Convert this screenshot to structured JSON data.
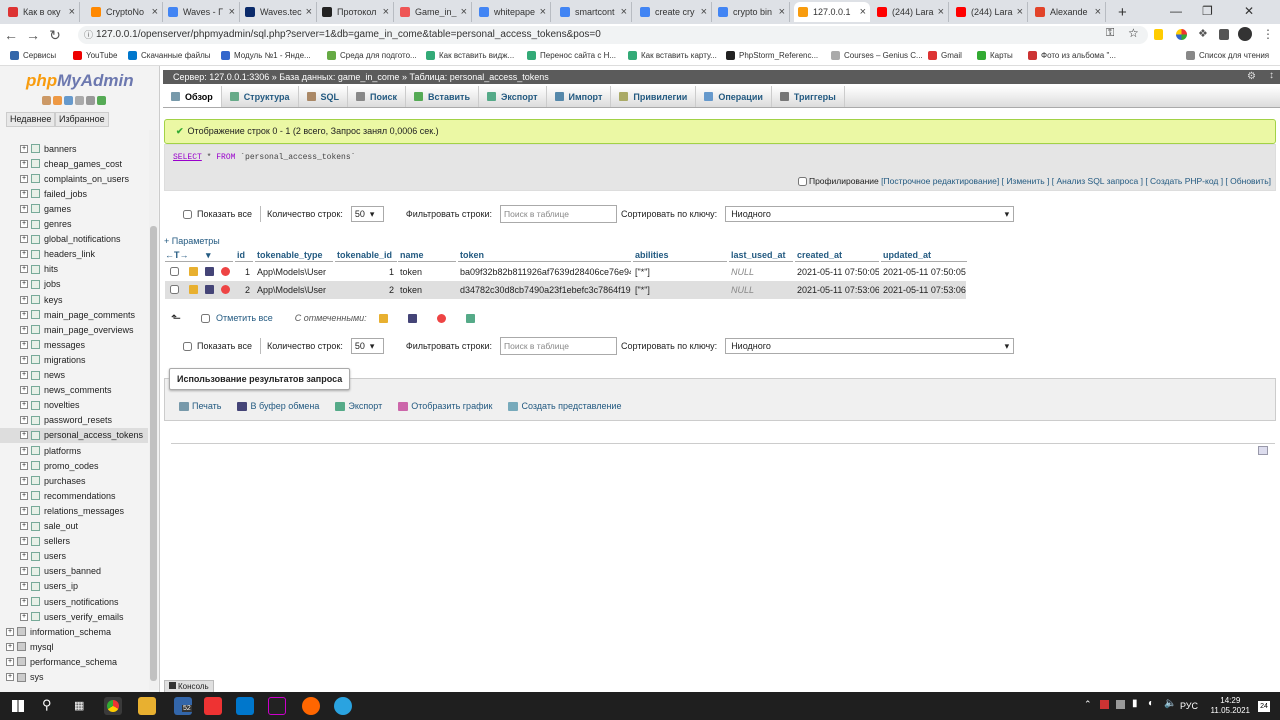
{
  "browser": {
    "tabs": [
      {
        "title": "Как в оку",
        "color": "#d33"
      },
      {
        "title": "CryptoNo",
        "color": "#f80"
      },
      {
        "title": "Waves - Г",
        "color": "#4285f4"
      },
      {
        "title": "Waves.tec",
        "color": "#0a2a6a"
      },
      {
        "title": "Протокол",
        "color": "#222"
      },
      {
        "title": "Game_in_",
        "color": "#e55"
      },
      {
        "title": "whitepape",
        "color": "#4285f4"
      },
      {
        "title": "smartcont",
        "color": "#4285f4"
      },
      {
        "title": "create cry",
        "color": "#4285f4"
      },
      {
        "title": "crypto bin",
        "color": "#4285f4"
      },
      {
        "title": "127.0.0.1",
        "color": "#f89c0e"
      },
      {
        "title": "(244) Lara",
        "color": "#f00"
      },
      {
        "title": "(244) Lara",
        "color": "#f00"
      },
      {
        "title": "Alexande",
        "color": "#e24329"
      }
    ],
    "new_tab": "+",
    "url": "127.0.0.1/openserver/phpmyadmin/sql.php?server=1&db=game_in_come&table=personal_access_tokens&pos=0",
    "bookmarks": [
      "Сервисы",
      "YouTube",
      "Скачанные файлы",
      "Модуль №1 - Яндe...",
      "Среда для подгото...",
      "Как вставить видж...",
      "Перенос сайта с Н...",
      "Как вставить карту...",
      "PhpStorm_Referenc...",
      "Courses – Genius C...",
      "Gmail",
      "Карты",
      "Фото из альбома \"..."
    ],
    "reading_list": "Список для чтения"
  },
  "left": {
    "logo_php": "php",
    "logo_my": "MyAdmin",
    "recent": "Недавнее",
    "favorites": "Избранное",
    "tables": [
      "banners",
      "cheap_games_cost",
      "complaints_on_users",
      "failed_jobs",
      "games",
      "genres",
      "global_notifications",
      "headers_link",
      "hits",
      "jobs",
      "keys",
      "main_page_comments",
      "main_page_overviews",
      "messages",
      "migrations",
      "news",
      "news_comments",
      "novelties",
      "password_resets",
      "personal_access_tokens",
      "platforms",
      "promo_codes",
      "purchases",
      "recommendations",
      "relations_messages",
      "sale_out",
      "sellers",
      "users",
      "users_banned",
      "users_ip",
      "users_notifications",
      "users_verify_emails"
    ],
    "databases": [
      "information_schema",
      "mysql",
      "performance_schema",
      "sys"
    ],
    "selected": "personal_access_tokens"
  },
  "breadcrumb": {
    "server": "Сервер: 127.0.0.1:3306",
    "database": "База данных: game_in_come",
    "table": "Таблица: personal_access_tokens"
  },
  "tabs": [
    "Обзор",
    "Структура",
    "SQL",
    "Поиск",
    "Вставить",
    "Экспорт",
    "Импорт",
    "Привилегии",
    "Операции",
    "Триггеры"
  ],
  "success": "Отображение строк 0 - 1 (2 всего, Запрос занял 0,0006 сек.)",
  "sql": {
    "select": "SELECT",
    "star": " * ",
    "from": "FROM",
    "table": " `personal_access_tokens`",
    "profiling": "Профилирование",
    "links": "[Построчное редактирование] [ Изменить ] [ Анализ SQL запроса ] [ Создать PHP-код ] [ Обновить]"
  },
  "nav": {
    "show_all": "Показать все",
    "row_count": "Количество строк:",
    "row_count_value": "50",
    "filter": "Фильтровать строки:",
    "filter_placeholder": "Поиск в таблице",
    "sort": "Сортировать по ключу:",
    "sort_value": "Ниодного"
  },
  "params": "+ Параметры",
  "columns": [
    "id",
    "tokenable_type",
    "tokenable_id",
    "name",
    "token",
    "abilities",
    "last_used_at",
    "created_at",
    "updated_at"
  ],
  "rows": [
    {
      "id": "1",
      "tokenable_type": "App\\Models\\User",
      "tokenable_id": "1",
      "name": "token",
      "token": "ba09f32b82b811926af7639d28406ce76e947c1e047d435d39...",
      "abilities": "[\"*\"]",
      "last_used_at": "NULL",
      "created_at": "2021-05-11 07:50:05",
      "updated_at": "2021-05-11 07:50:05"
    },
    {
      "id": "2",
      "tokenable_type": "App\\Models\\User",
      "tokenable_id": "2",
      "name": "token",
      "token": "d34782c30d8cb7490a23f1ebefc3c7864f19ca2c9793d019c9...",
      "abilities": "[\"*\"]",
      "last_used_at": "NULL",
      "created_at": "2021-05-11 07:53:06",
      "updated_at": "2021-05-11 07:53:06"
    }
  ],
  "bulk": {
    "check_all": "Отметить все",
    "with_selected": "С отмеченными:"
  },
  "query_results": {
    "tooltip": "Использование результатов запроса",
    "print": "Печать",
    "clipboard": "В буфер обмена",
    "export": "Экспорт",
    "chart": "Отобразить график",
    "view": "Создать представление"
  },
  "console": "Консоль",
  "taskbar": {
    "lang": "РУС",
    "time": "14:29",
    "date": "11.05.2021",
    "badge": "52",
    "notif": "24"
  }
}
